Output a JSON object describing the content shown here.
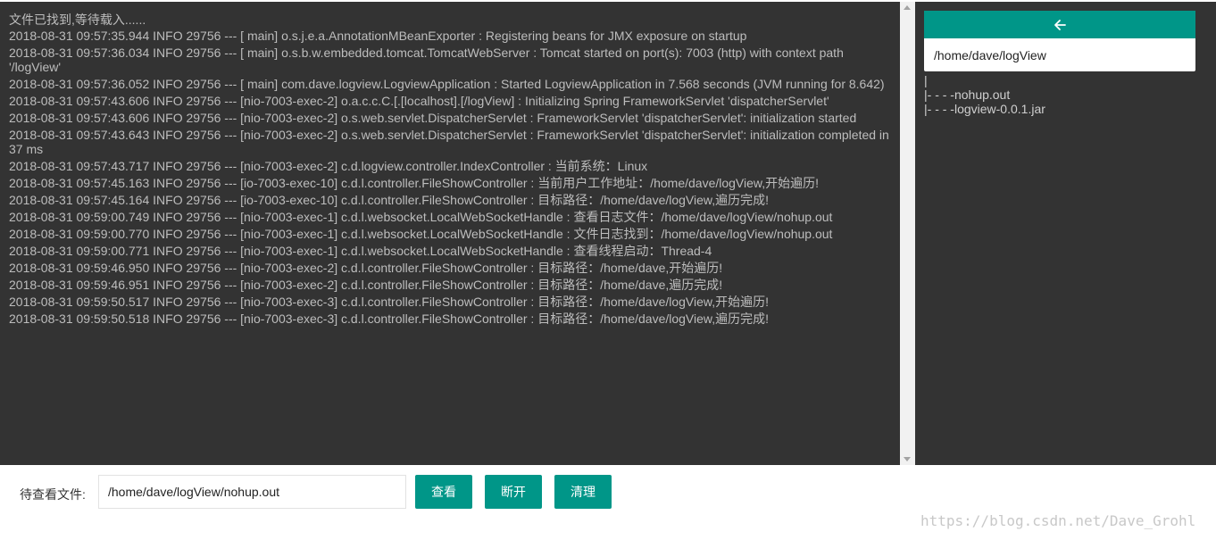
{
  "log": {
    "lines": [
      "文件已找到,等待载入......",
      "2018-08-31 09:57:35.944 INFO 29756 --- [ main] o.s.j.e.a.AnnotationMBeanExporter : Registering beans for JMX exposure on startup",
      "2018-08-31 09:57:36.034 INFO 29756 --- [ main] o.s.b.w.embedded.tomcat.TomcatWebServer : Tomcat started on port(s): 7003 (http) with context path '/logView'",
      "2018-08-31 09:57:36.052 INFO 29756 --- [ main] com.dave.logview.LogviewApplication : Started LogviewApplication in 7.568 seconds (JVM running for 8.642)",
      "2018-08-31 09:57:43.606 INFO 29756 --- [nio-7003-exec-2] o.a.c.c.C.[.[localhost].[/logView] : Initializing Spring FrameworkServlet 'dispatcherServlet'",
      "2018-08-31 09:57:43.606 INFO 29756 --- [nio-7003-exec-2] o.s.web.servlet.DispatcherServlet : FrameworkServlet 'dispatcherServlet': initialization started",
      "2018-08-31 09:57:43.643 INFO 29756 --- [nio-7003-exec-2] o.s.web.servlet.DispatcherServlet : FrameworkServlet 'dispatcherServlet': initialization completed in 37 ms",
      "2018-08-31 09:57:43.717 INFO 29756 --- [nio-7003-exec-2] c.d.logview.controller.IndexController : 当前系统：Linux",
      "2018-08-31 09:57:45.163 INFO 29756 --- [io-7003-exec-10] c.d.l.controller.FileShowController : 当前用户工作地址：/home/dave/logView,开始遍历!",
      "2018-08-31 09:57:45.164 INFO 29756 --- [io-7003-exec-10] c.d.l.controller.FileShowController : 目标路径：/home/dave/logView,遍历完成!",
      "2018-08-31 09:59:00.749 INFO 29756 --- [nio-7003-exec-1] c.d.l.websocket.LocalWebSocketHandle : 查看日志文件：/home/dave/logView/nohup.out",
      "2018-08-31 09:59:00.770 INFO 29756 --- [nio-7003-exec-1] c.d.l.websocket.LocalWebSocketHandle : 文件日志找到：/home/dave/logView/nohup.out",
      "2018-08-31 09:59:00.771 INFO 29756 --- [nio-7003-exec-1] c.d.l.websocket.LocalWebSocketHandle : 查看线程启动：Thread-4",
      "2018-08-31 09:59:46.950 INFO 29756 --- [nio-7003-exec-2] c.d.l.controller.FileShowController : 目标路径：/home/dave,开始遍历!",
      "2018-08-31 09:59:46.951 INFO 29756 --- [nio-7003-exec-2] c.d.l.controller.FileShowController : 目标路径：/home/dave,遍历完成!",
      "2018-08-31 09:59:50.517 INFO 29756 --- [nio-7003-exec-3] c.d.l.controller.FileShowController : 目标路径：/home/dave/logView,开始遍历!",
      "2018-08-31 09:59:50.518 INFO 29756 --- [nio-7003-exec-3] c.d.l.controller.FileShowController : 目标路径：/home/dave/logView,遍历完成!"
    ]
  },
  "dir_panel": {
    "back_icon": "arrow-left-icon",
    "current_path": "/home/dave/logView",
    "tree": [
      "|",
      "|- - - -nohup.out",
      "|- - - -logview-0.0.1.jar"
    ]
  },
  "controls": {
    "file_label": "待查看文件:",
    "file_value": "/home/dave/logView/nohup.out",
    "view_label": "查看",
    "disconnect_label": "断开",
    "clear_label": "清理"
  },
  "watermark": "https://blog.csdn.net/Dave_Grohl",
  "colors": {
    "accent": "#009688",
    "panel_bg": "#333333",
    "log_text": "#bdbdbd"
  }
}
